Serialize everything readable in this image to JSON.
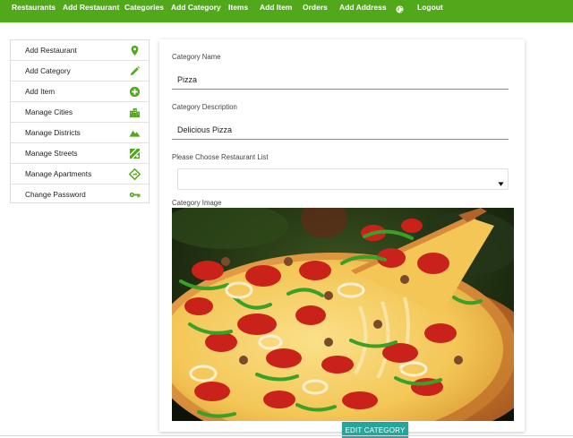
{
  "nav": {
    "items": [
      {
        "label": "Restaurants"
      },
      {
        "label": "Add Restaurant"
      },
      {
        "label": "Categories"
      },
      {
        "label": "Add Category"
      },
      {
        "label": "Items"
      },
      {
        "label": "Add Item"
      },
      {
        "label": "Orders"
      },
      {
        "label": "Add Address"
      },
      {
        "label": "Logout"
      }
    ],
    "globe_icon": "globe-icon",
    "bar_color": "#52a81b"
  },
  "sidebar": {
    "items": [
      {
        "label": "Add Restaurant",
        "icon": "map-marker-icon"
      },
      {
        "label": "Add Category",
        "icon": "pencil-icon"
      },
      {
        "label": "Add Item",
        "icon": "plus-circle-icon"
      },
      {
        "label": "Manage Cities",
        "icon": "city-icon"
      },
      {
        "label": "Manage Districts",
        "icon": "mountain-icon"
      },
      {
        "label": "Manage Streets",
        "icon": "street-map-icon"
      },
      {
        "label": "Manage Apartments",
        "icon": "diamond-direction-icon"
      },
      {
        "label": "Change Password",
        "icon": "key-icon"
      }
    ],
    "icon_color": "#52a81b"
  },
  "form": {
    "name_label": "Category Name",
    "name_value": "Pizza",
    "description_label": "Category Description",
    "description_value": "Delicious Pizza",
    "restaurant_label": "Please Choose Restaurant List",
    "restaurant_value": "",
    "image_label": "Category Image",
    "image_alt": "pizza-photo",
    "submit_label": "EDIT CATEGORY",
    "submit_color": "#26a69a"
  }
}
